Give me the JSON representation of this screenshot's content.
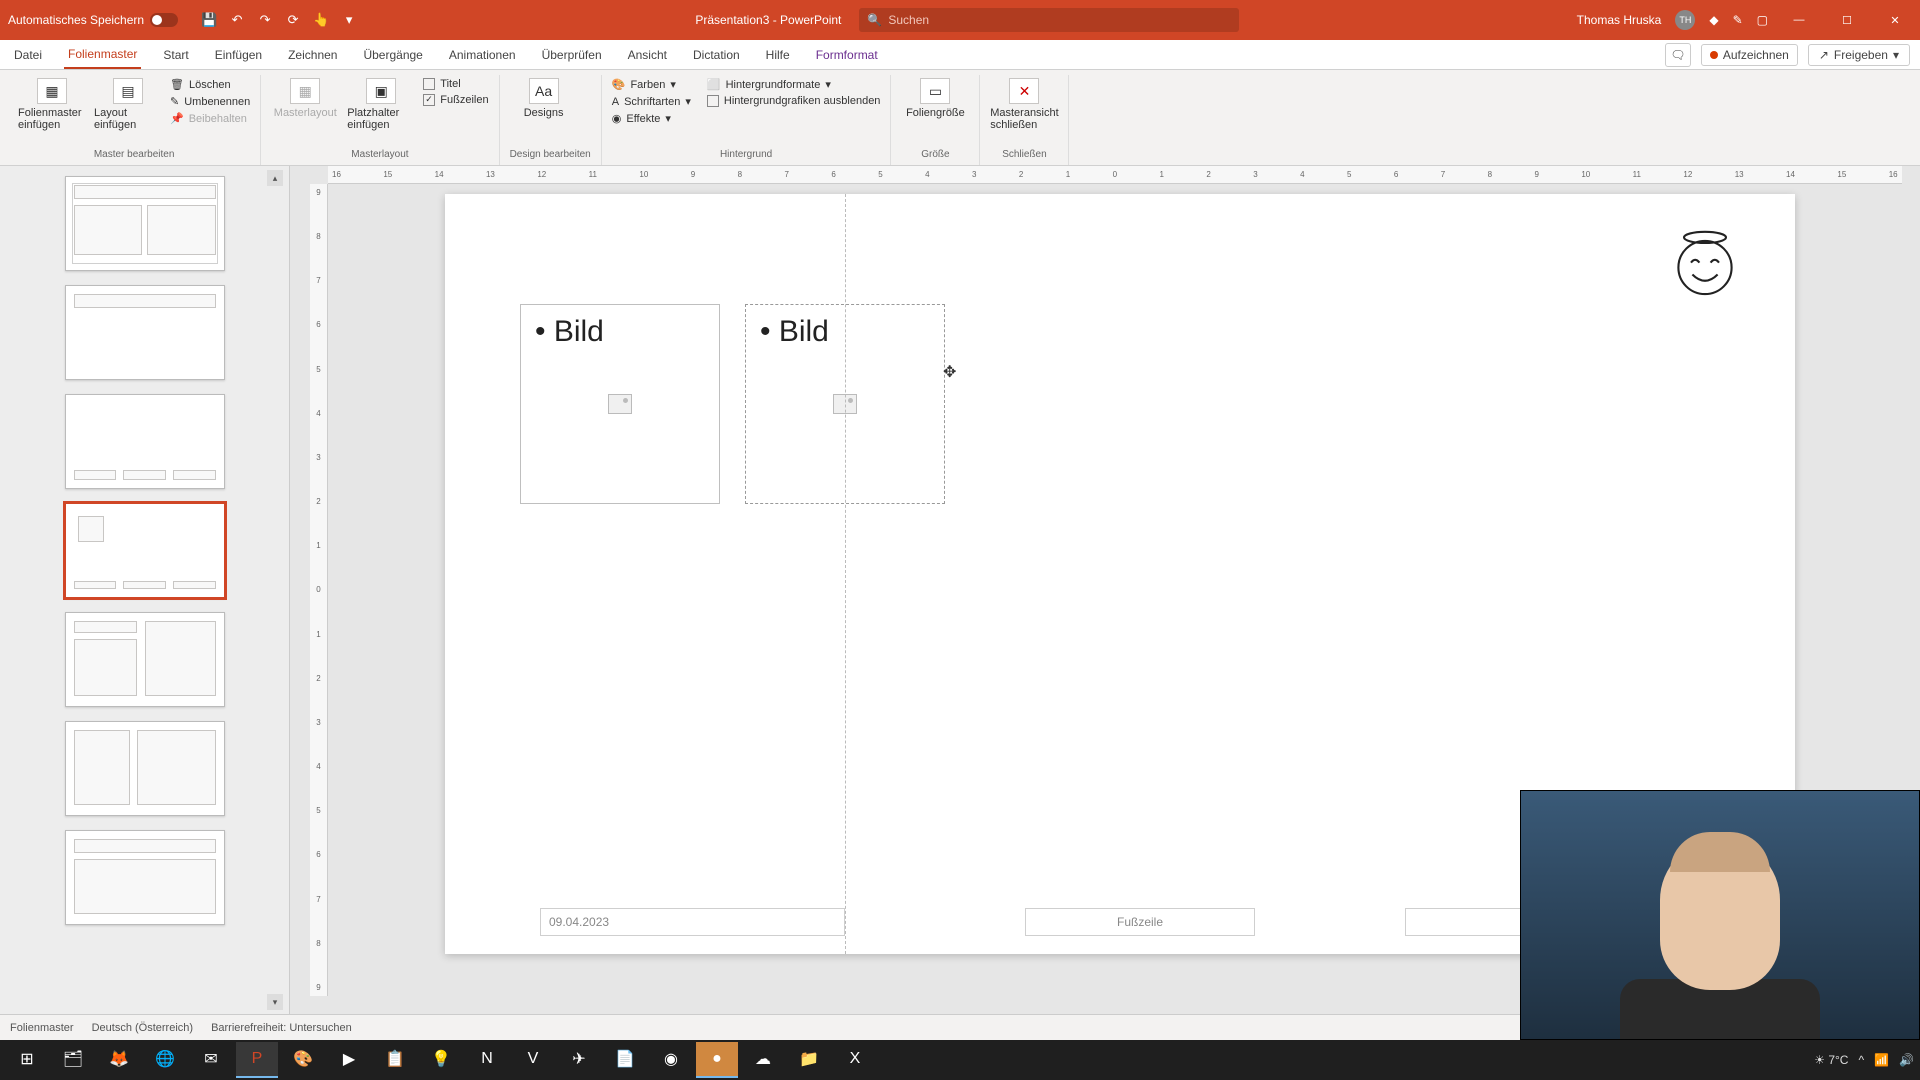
{
  "titlebar": {
    "autosave_label": "Automatisches Speichern",
    "doc_title": "Präsentation3 - PowerPoint",
    "search_placeholder": "Suchen",
    "user_name": "Thomas Hruska",
    "user_initials": "TH"
  },
  "tabs": {
    "items": [
      "Datei",
      "Folienmaster",
      "Start",
      "Einfügen",
      "Zeichnen",
      "Übergänge",
      "Animationen",
      "Überprüfen",
      "Ansicht",
      "Dictation",
      "Hilfe",
      "Formformat"
    ],
    "active_index": 1,
    "record": "Aufzeichnen",
    "share": "Freigeben"
  },
  "ribbon": {
    "groups": {
      "master_edit": {
        "label": "Master bearbeiten",
        "folienmaster": "Folienmaster einfügen",
        "layout": "Layout einfügen",
        "delete": "Löschen",
        "rename": "Umbenennen",
        "keep": "Beibehalten"
      },
      "master_layout": {
        "label": "Masterlayout",
        "masterlayout_btn": "Masterlayout",
        "platzhalter": "Platzhalter einfügen",
        "titel": "Titel",
        "fusszeilen": "Fußzeilen"
      },
      "design_edit": {
        "label": "Design bearbeiten",
        "designs": "Designs"
      },
      "background": {
        "label": "Hintergrund",
        "farben": "Farben",
        "schriftarten": "Schriftarten",
        "effekte": "Effekte",
        "hgformate": "Hintergrundformate",
        "hide_bg": "Hintergrundgrafiken ausblenden"
      },
      "size": {
        "label": "Größe",
        "foliengroesse": "Foliengröße"
      },
      "close": {
        "label": "Schließen",
        "masteransicht": "Masteransicht schließen"
      }
    }
  },
  "slide": {
    "bild1": "Bild",
    "bild2": "Bild",
    "date": "09.04.2023",
    "footer": "Fußzeile"
  },
  "statusbar": {
    "view": "Folienmaster",
    "lang": "Deutsch (Österreich)",
    "accessibility": "Barrierefreiheit: Untersuchen"
  },
  "taskbar": {
    "weather": "7°C"
  },
  "ruler_h": [
    "16",
    "15",
    "14",
    "13",
    "12",
    "11",
    "10",
    "9",
    "8",
    "7",
    "6",
    "5",
    "4",
    "3",
    "2",
    "1",
    "0",
    "1",
    "2",
    "3",
    "4",
    "5",
    "6",
    "7",
    "8",
    "9",
    "10",
    "11",
    "12",
    "13",
    "14",
    "15",
    "16"
  ],
  "ruler_v": [
    "9",
    "8",
    "7",
    "6",
    "5",
    "4",
    "3",
    "2",
    "1",
    "0",
    "1",
    "2",
    "3",
    "4",
    "5",
    "6",
    "7",
    "8",
    "9"
  ]
}
